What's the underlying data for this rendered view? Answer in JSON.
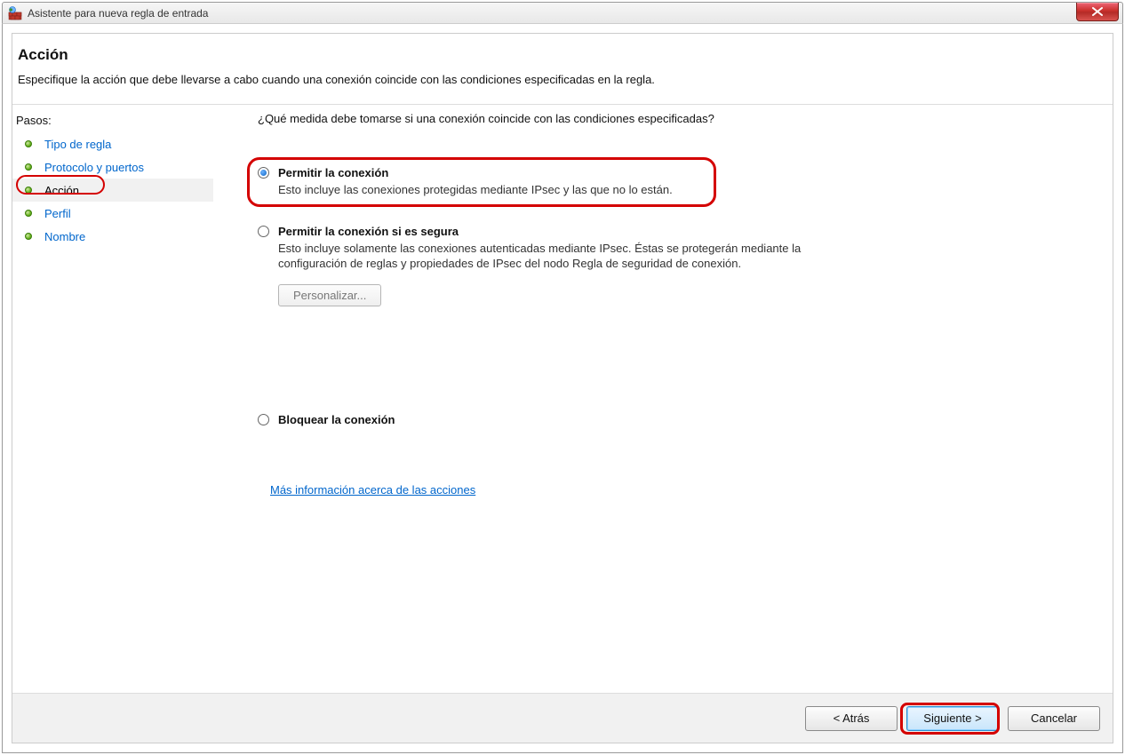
{
  "window": {
    "title": "Asistente para nueva regla de entrada"
  },
  "header": {
    "title": "Acción",
    "subtitle": "Especifique la acción que debe llevarse a cabo cuando una conexión coincide con las condiciones especificadas en la regla."
  },
  "sidebar": {
    "pasos_label": "Pasos:",
    "steps": [
      {
        "label": "Tipo de regla",
        "current": false
      },
      {
        "label": "Protocolo y puertos",
        "current": false
      },
      {
        "label": "Acción",
        "current": true
      },
      {
        "label": "Perfil",
        "current": false
      },
      {
        "label": "Nombre",
        "current": false
      }
    ]
  },
  "main": {
    "question": "¿Qué medida debe tomarse si una conexión coincide con las condiciones especificadas?",
    "options": [
      {
        "selected": true,
        "title": "Permitir la conexión",
        "desc": "Esto incluye las conexiones protegidas mediante IPsec y las que no lo están."
      },
      {
        "selected": false,
        "title": "Permitir la conexión si es segura",
        "desc": "Esto incluye solamente las conexiones autenticadas mediante IPsec. Éstas se protegerán mediante la configuración de reglas y propiedades de IPsec del nodo Regla de seguridad de conexión.",
        "customize_label": "Personalizar..."
      },
      {
        "selected": false,
        "title": "Bloquear la conexión"
      }
    ],
    "more_info": "Más información acerca de las acciones"
  },
  "footer": {
    "back": "< Atrás",
    "next": "Siguiente >",
    "cancel": "Cancelar"
  }
}
